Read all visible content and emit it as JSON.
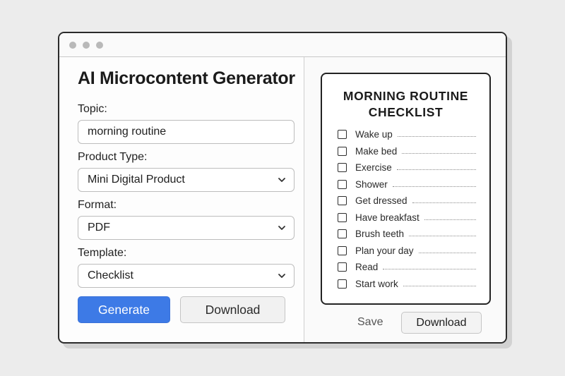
{
  "app": {
    "title": "AI Microcontent Generator"
  },
  "form": {
    "topic": {
      "label": "Topic:",
      "value": "morning routine"
    },
    "product_type": {
      "label": "Product Type:",
      "value": "Mini Digital Product"
    },
    "format": {
      "label": "Format:",
      "value": "PDF"
    },
    "template": {
      "label": "Template:",
      "value": "Checklist"
    }
  },
  "actions": {
    "generate_label": "Generate",
    "download_label": "Download"
  },
  "preview": {
    "title_line1": "MORNING ROUTINE",
    "title_line2": "CHECKLIST",
    "items": [
      {
        "label": "Wake up",
        "checked": false
      },
      {
        "label": "Make bed",
        "checked": false
      },
      {
        "label": "Exercise",
        "checked": false
      },
      {
        "label": "Shower",
        "checked": false
      },
      {
        "label": "Get dressed",
        "checked": false
      },
      {
        "label": "Have breakfast",
        "checked": false
      },
      {
        "label": "Brush teeth",
        "checked": false
      },
      {
        "label": "Plan your day",
        "checked": false
      },
      {
        "label": "Read",
        "checked": false
      },
      {
        "label": "Start work",
        "checked": false
      }
    ],
    "save_label": "Save",
    "download_label": "Download"
  },
  "colors": {
    "accent": "#3d7ae6",
    "window_border": "#2b2b2b",
    "background": "#ececec"
  },
  "icons": {
    "select_arrow": "chevron-down-icon",
    "window_controls": "window-dot-icon"
  }
}
